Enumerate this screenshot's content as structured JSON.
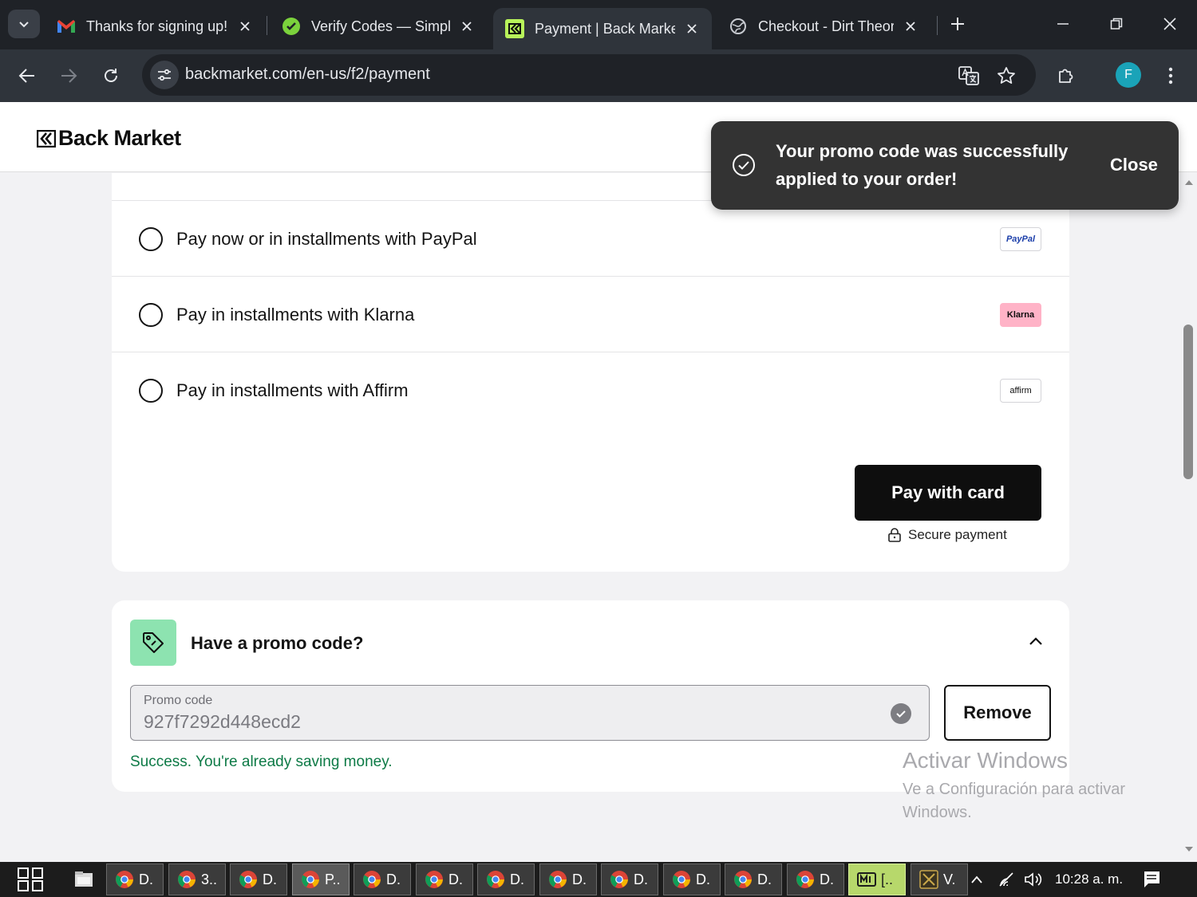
{
  "browser": {
    "tabs": [
      {
        "title": "Thanks for signing up!",
        "icon": "gmail-icon"
      },
      {
        "title": "Verify Codes — SimplyCodes",
        "icon": "simplycodes-icon"
      },
      {
        "title": "Payment | Back Market",
        "icon": "backmarket-icon",
        "active": true
      },
      {
        "title": "Checkout - Dirt Theory",
        "icon": "globe-icon"
      }
    ],
    "url": "backmarket.com/en-us/f2/payment",
    "profile_initial": "F"
  },
  "site": {
    "logo_text": "Back Market"
  },
  "toast": {
    "message": "Your promo code was successfully applied to your order!",
    "close_label": "Close"
  },
  "payment": {
    "options": [
      {
        "label": "Pay now or in installments with PayPal",
        "brand": "PayPal",
        "brand_bg": "#ffffff",
        "brand_color": "#1c3faa"
      },
      {
        "label": "Pay in installments with Klarna",
        "brand": "Klarna",
        "brand_bg": "#ffb3c7",
        "brand_color": "#0e0e0e"
      },
      {
        "label": "Pay in installments with Affirm",
        "brand": "affirm",
        "brand_bg": "#ffffff",
        "brand_color": "#0e0e0e"
      }
    ],
    "pay_button": "Pay with card",
    "secure_label": "Secure payment"
  },
  "promo": {
    "title": "Have a promo code?",
    "input_label": "Promo code",
    "input_value": "927f7292d448ecd2",
    "remove_label": "Remove",
    "success_message": "Success. You're already saving money."
  },
  "watermark": {
    "line1": "Activar Windows",
    "line2": "Ve a Configuración para activar Windows."
  },
  "taskbar": {
    "items": [
      "D.",
      "3..",
      "D.",
      "P..",
      "D.",
      "D.",
      "D.",
      "D.",
      "D.",
      "D.",
      "D.",
      "D.",
      "[..",
      "V."
    ],
    "clock": "10:28 a. m."
  },
  "colors": {
    "accent_green": "#8de3b0",
    "success_text": "#0d7a46",
    "toast_bg": "#333333"
  }
}
